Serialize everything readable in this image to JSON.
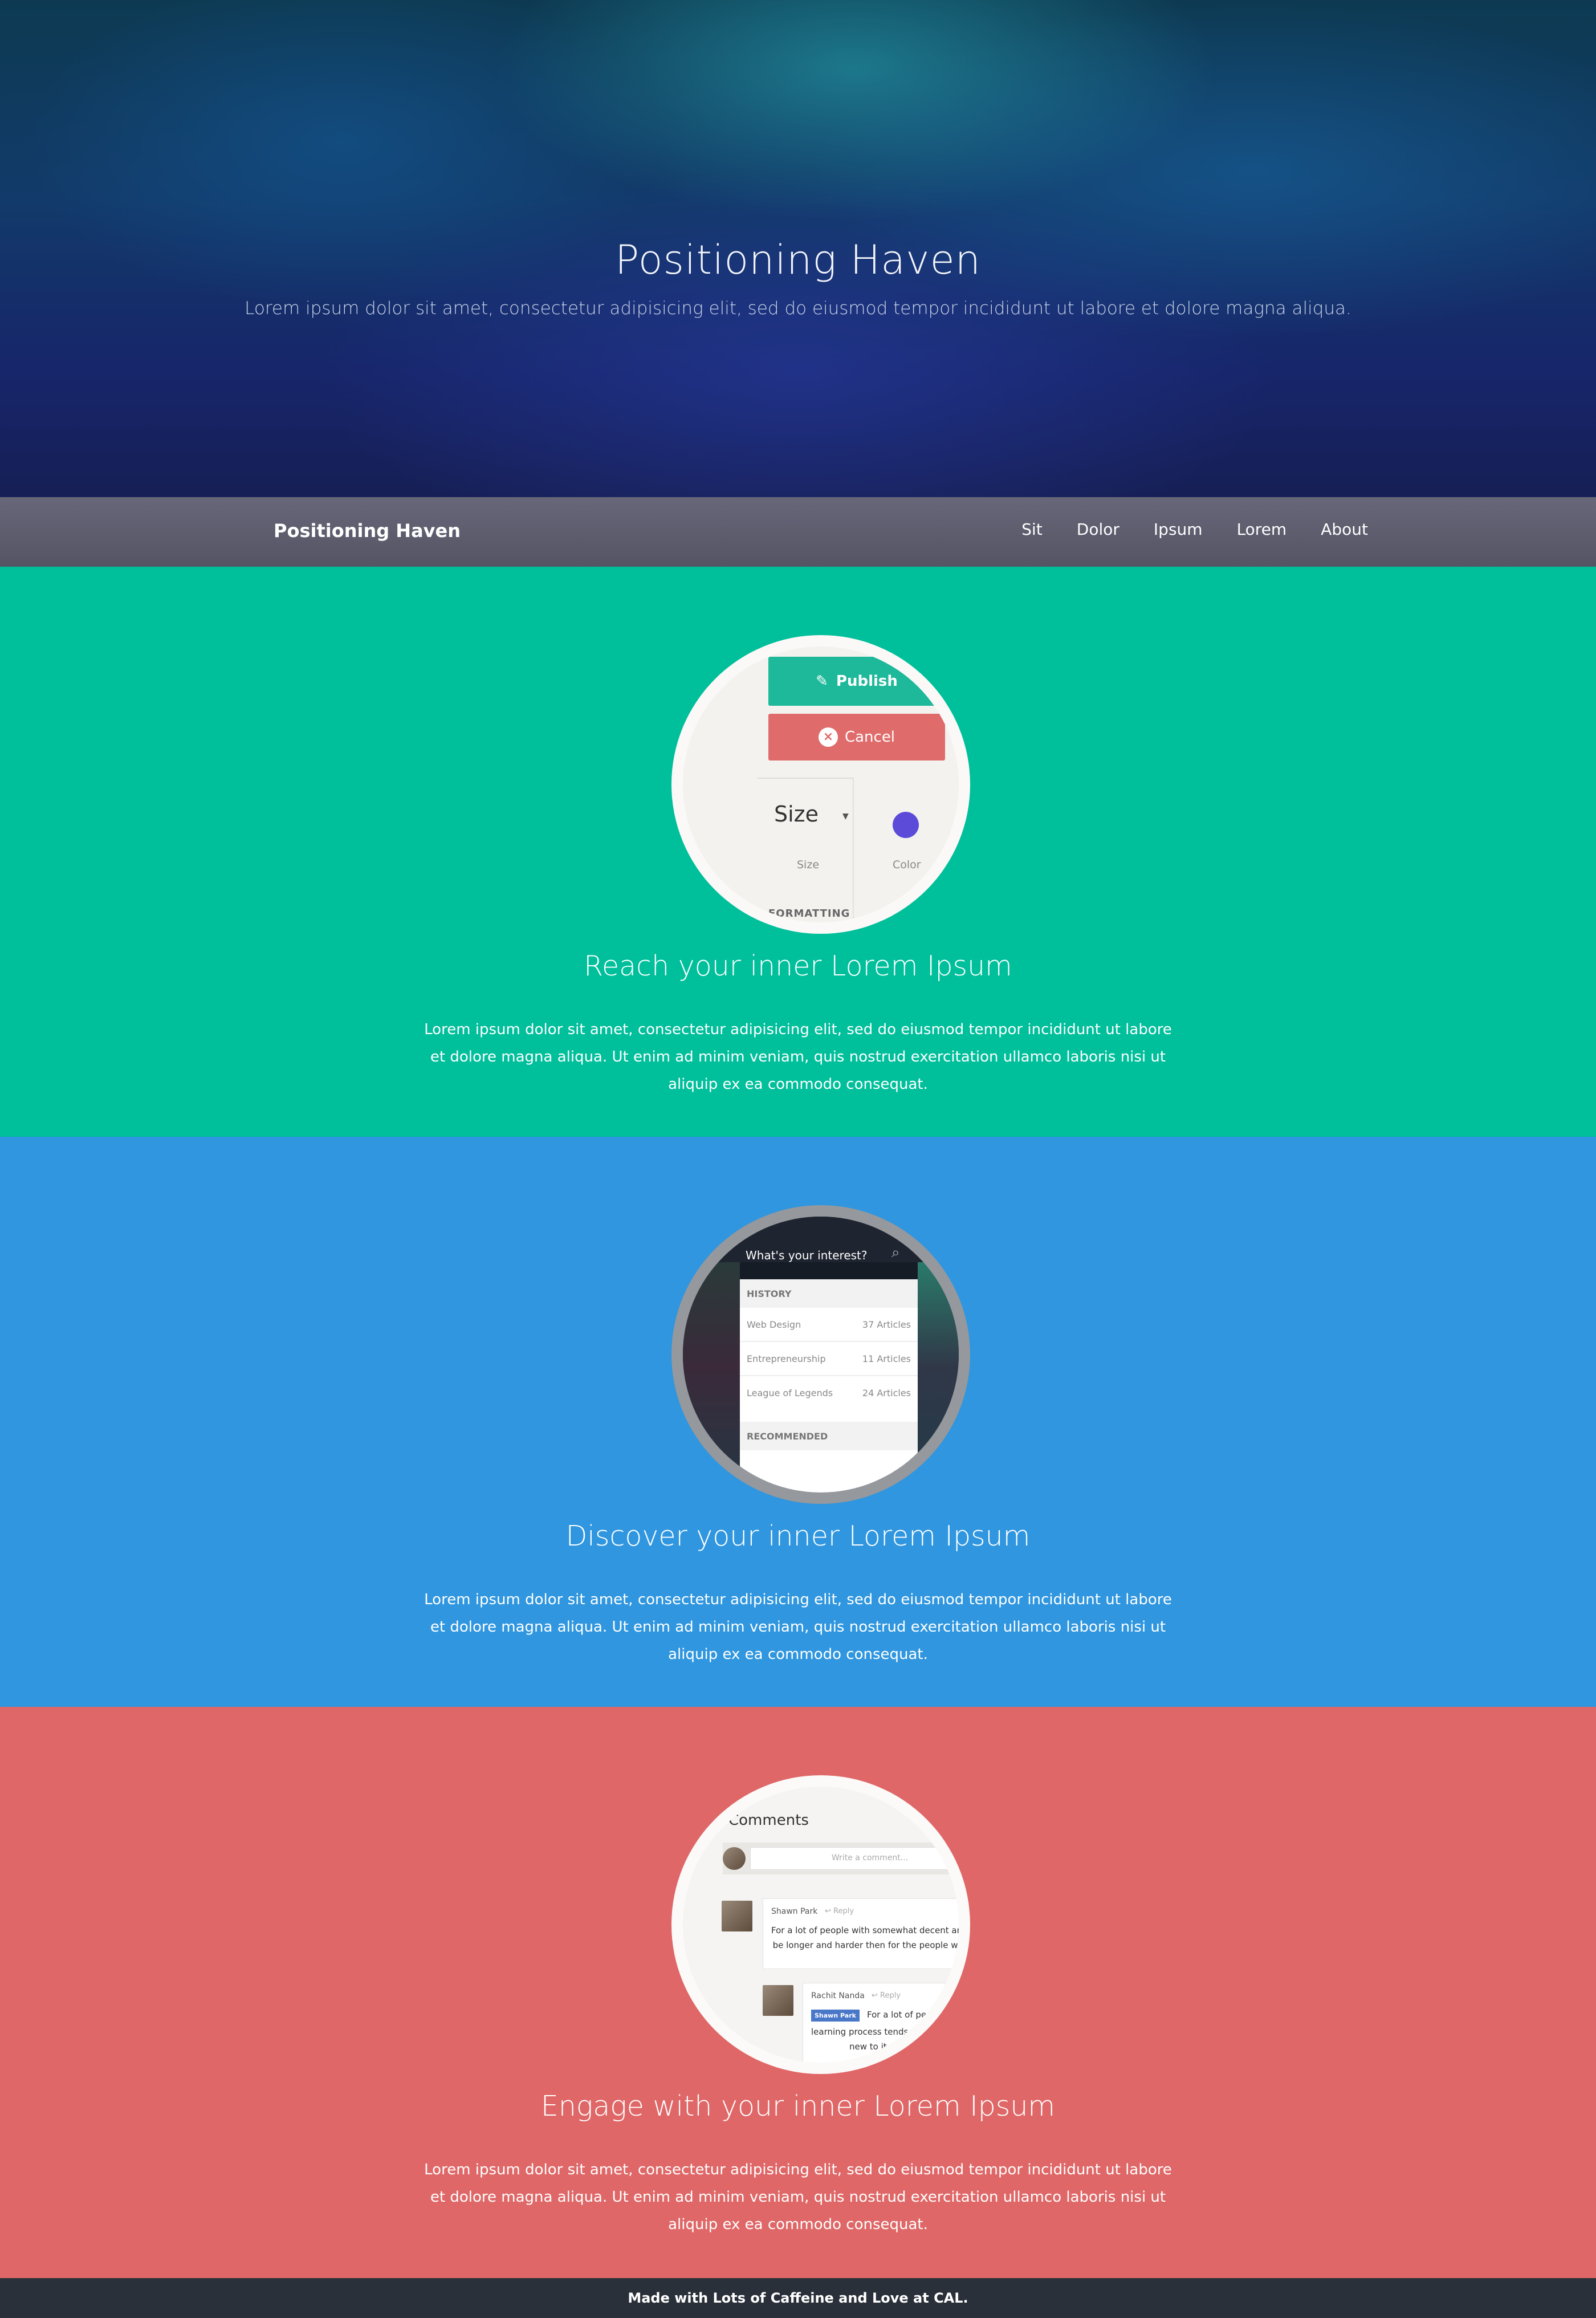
{
  "hero": {
    "title": "Positioning Haven",
    "subtitle": "Lorem ipsum dolor sit amet, consectetur adipisicing elit, sed do eiusmod tempor incididunt ut labore et dolore magna aliqua."
  },
  "navbar": {
    "brand": "Positioning Haven",
    "links": [
      "Sit",
      "Dolor",
      "Ipsum",
      "Lorem",
      "About"
    ]
  },
  "sections": [
    {
      "title": "Reach your inner Lorem Ipsum",
      "text": "Lorem ipsum dolor sit amet, consectetur adipisicing elit, sed do eiusmod tempor incididunt ut labore et dolore magna aliqua. Ut enim ad minim veniam, quis nostrud exercitation ullamco laboris nisi ut aliquip ex ea commodo consequat.",
      "color": "#00bf9b",
      "mock": {
        "publish": "Publish",
        "cancel": "Cancel",
        "size": "Size",
        "size_caption": "Size",
        "color_caption": "Color",
        "formatting": "FORMATTING"
      }
    },
    {
      "title": "Discover your inner Lorem Ipsum",
      "text": "Lorem ipsum dolor sit amet, consectetur adipisicing elit, sed do eiusmod tempor incididunt ut labore et dolore magna aliqua. Ut enim ad minim veniam, quis nostrud exercitation ullamco laboris nisi ut aliquip ex ea commodo consequat.",
      "color": "#2f96df",
      "mock": {
        "question": "What's your interest?",
        "history": "HISTORY",
        "rows": [
          {
            "label": "Web Design",
            "count": "37 Articles"
          },
          {
            "label": "Entrepreneurship",
            "count": "11 Articles"
          },
          {
            "label": "League of Legends",
            "count": "24 Articles"
          }
        ],
        "recommended": "RECOMMENDED"
      }
    },
    {
      "title": "Engage with your inner Lorem Ipsum",
      "text": "Lorem ipsum dolor sit amet, consectetur adipisicing elit, sed do eiusmod tempor incididunt ut labore et dolore magna aliqua. Ut enim ad minim veniam, quis nostrud exercitation ullamco laboris nisi ut aliquip ex ea commodo consequat.",
      "color": "#e06767",
      "mock": {
        "title": "Comments",
        "placeholder": "Write a comment...",
        "c1_name": "Shawn Park",
        "c1_reply": "Reply",
        "c1_body": "For a lot of people with somewhat decent artsy an\nbe longer and harder then for the people who are",
        "c2_name": "Rachit Nanda",
        "c2_reply": "Reply",
        "c2_tag": "Shawn Park",
        "c2_body_first": "For a lot of peopl",
        "c2_body": "learning process tends to b\nnew to it."
      }
    }
  ],
  "footer": {
    "text": "Made with Lots of Caffeine and Love at CAL."
  }
}
